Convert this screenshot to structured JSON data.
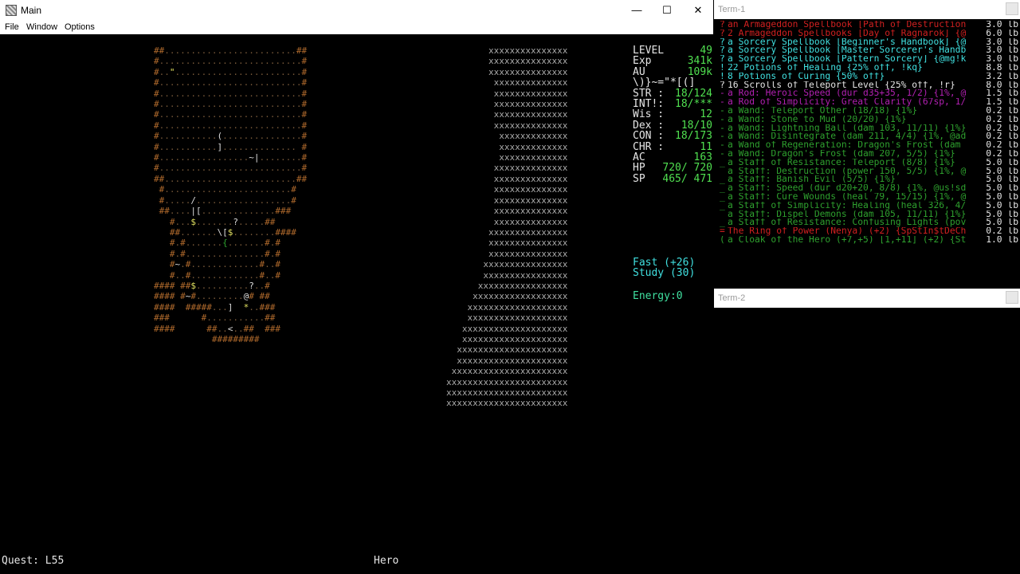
{
  "main_window": {
    "title": "Main",
    "controls": {
      "minimize": "—",
      "maximize": "☐",
      "close": "✕"
    },
    "menu": [
      "File",
      "Window",
      "Options"
    ]
  },
  "map": {
    "dungeon_rows": [
      "##.........................##",
      "#...........................#",
      "#..\"........................#",
      "#...........................#",
      "#...........................#",
      "#...........................#",
      "#...........................#",
      "#...........................#",
      "#...........(...............#",
      "#...........].............. #",
      "#.................~|........#",
      "#...........................#",
      "##.........................##",
      " #........................#",
      " #...../..................#",
      " ##....|[..............###",
      "   #...$.......?.....##",
      "   ##.......\\[$........####",
      "   #.#.......{.......#.#",
      "   #.#...............#.#",
      "   #~.#.............#..#",
      "   #..#.............#..#",
      "#### ##$..........?..#",
      "#### #~#.........@# ##",
      "####  #####...]  *..###",
      "###      #...........##",
      "####      ##..<..##  ###",
      "           #########"
    ],
    "x_rows": [
      "        xxxxxxxxxxxxxxx",
      "        xxxxxxxxxxxxxxx",
      "        xxxxxxxxxxxxxxx",
      "         xxxxxxxxxxxxxx",
      "         xxxxxxxxxxxxxx",
      "         xxxxxxxxxxxxxx",
      "         xxxxxxxxxxxxxx",
      "         xxxxxxxxxxxxxx",
      "          xxxxxxxxxxxxx",
      "          xxxxxxxxxxxxx",
      "          xxxxxxxxxxxxx",
      "         xxxxxxxxxxxxxx",
      "         xxxxxxxxxxxxxx",
      "         xxxxxxxxxxxxxx",
      "         xxxxxxxxxxxxxx",
      "         xxxxxxxxxxxxxx",
      "         xxxxxxxxxxxxxx",
      "        xxxxxxxxxxxxxxx",
      "        xxxxxxxxxxxxxxx",
      "        xxxxxxxxxxxxxxx",
      "       xxxxxxxxxxxxxxxx",
      "       xxxxxxxxxxxxxxxx",
      "      xxxxxxxxxxxxxxxxx",
      "     xxxxxxxxxxxxxxxxxx",
      "    xxxxxxxxxxxxxxxxxxx",
      "    xxxxxxxxxxxxxxxxxxx",
      "   xxxxxxxxxxxxxxxxxxxx",
      "   xxxxxxxxxxxxxxxxxxxx",
      "  xxxxxxxxxxxxxxxxxxxxx",
      "  xxxxxxxxxxxxxxxxxxxxx",
      " xxxxxxxxxxxxxxxxxxxxxx",
      "xxxxxxxxxxxxxxxxxxxxxxx",
      "xxxxxxxxxxxxxxxxxxxxxxx",
      "xxxxxxxxxxxxxxxxxxxxxxx"
    ]
  },
  "stats": [
    {
      "label": "LEVEL",
      "value": "49",
      "color": "#50e050"
    },
    {
      "label": "Exp",
      "value": "341k",
      "color": "#50e050"
    },
    {
      "label": "AU",
      "value": "109k",
      "color": "#50e050"
    },
    {
      "label": "\\)}~=\"*[(]",
      "value": "",
      "color": "#e6e6e6"
    },
    {
      "label": "STR :",
      "value": "18/124",
      "color": "#50e050"
    },
    {
      "label": "INT!:",
      "value": "18/***",
      "color": "#50e050"
    },
    {
      "label": "Wis :",
      "value": "12",
      "color": "#50e050"
    },
    {
      "label": "Dex :",
      "value": "18/10",
      "color": "#50e050"
    },
    {
      "label": "CON :",
      "value": "18/173",
      "color": "#50e050"
    },
    {
      "label": "CHR :",
      "value": "11",
      "color": "#50e050"
    },
    {
      "label": "AC",
      "value": "163",
      "color": "#50e050"
    },
    {
      "label": "HP",
      "value": "720/ 720",
      "color": "#50e050"
    },
    {
      "label": "SP",
      "value": "465/ 471",
      "color": "#50e050"
    }
  ],
  "status": {
    "fast": "Fast (+26)",
    "study": "Study (30)",
    "energy": "Energy:0"
  },
  "bottom": {
    "quest": "Quest: L55",
    "hero": "Hero"
  },
  "term1": {
    "title": "Term-1",
    "items": [
      {
        "sym": "?",
        "text": "an Armageddon Spellbook [Path of Destruction",
        "weight": "3.0 lb",
        "color": "#d02020"
      },
      {
        "sym": "?",
        "text": "2 Armageddon Spellbooks [Day of Ragnarok] {@",
        "weight": "6.0 lb",
        "color": "#d02020"
      },
      {
        "sym": "?",
        "text": "a Sorcery Spellbook [Beginner's Handbook] {@",
        "weight": "3.0 lb",
        "color": "#40e0e0"
      },
      {
        "sym": "?",
        "text": "a Sorcery Spellbook [Master Sorcerer's Handb",
        "weight": "3.0 lb",
        "color": "#40e0e0"
      },
      {
        "sym": "?",
        "text": "a Sorcery Spellbook [Pattern Sorcery] {@mg!k",
        "weight": "3.0 lb",
        "color": "#40e0e0"
      },
      {
        "sym": "!",
        "text": "22 Potions of Healing {25% off, !kq}",
        "weight": "8.8 lb",
        "color": "#40e0e0"
      },
      {
        "sym": "!",
        "text": "8 Potions of Curing {50% off}",
        "weight": "3.2 lb",
        "color": "#40e0e0"
      },
      {
        "sym": "?",
        "text": "16 Scrolls of Teleport Level {25% off, !r}",
        "weight": "8.0 lb",
        "color": "#e6e6e6"
      },
      {
        "sym": "-",
        "text": "a Rod: Heroic Speed (dur d35+35, 1/2) {1%, @",
        "weight": "1.5 lb",
        "color": "#b020b0"
      },
      {
        "sym": "-",
        "text": "a Rod of Simplicity: Great Clarity (67sp, 1/",
        "weight": "1.5 lb",
        "color": "#b020b0"
      },
      {
        "sym": "-",
        "text": "a Wand: Teleport Other (18/18) {1%}",
        "weight": "0.2 lb",
        "color": "#2ea02e"
      },
      {
        "sym": "-",
        "text": "a Wand: Stone to Mud (20/20) {1%}",
        "weight": "0.2 lb",
        "color": "#2ea02e"
      },
      {
        "sym": "-",
        "text": "a Wand: Lightning Ball (dam 103, 11/11) {1%}",
        "weight": "0.2 lb",
        "color": "#2ea02e"
      },
      {
        "sym": "-",
        "text": "a Wand: Disintegrate (dam 211, 4/4) {1%, @ad",
        "weight": "0.2 lb",
        "color": "#2ea02e"
      },
      {
        "sym": "-",
        "text": "a Wand of Regeneration: Dragon's Frost (dam",
        "weight": "0.2 lb",
        "color": "#2ea02e"
      },
      {
        "sym": "-",
        "text": "a Wand: Dragon's Frost (dam 207, 5/5) {1%}",
        "weight": "0.2 lb",
        "color": "#2ea02e"
      },
      {
        "sym": "_",
        "text": "a Staff of Resistance: Teleport (8/8) {1%}",
        "weight": "5.0 lb",
        "color": "#2ea02e"
      },
      {
        "sym": "_",
        "text": "a Staff: Destruction (power 150, 5/5) {1%, @",
        "weight": "5.0 lb",
        "color": "#2ea02e"
      },
      {
        "sym": "_",
        "text": "a Staff: Banish Evil (5/5) {1%}",
        "weight": "5.0 lb",
        "color": "#2ea02e"
      },
      {
        "sym": "_",
        "text": "a Staff: Speed (dur d20+20, 8/8) {1%, @us!sd",
        "weight": "5.0 lb",
        "color": "#2ea02e"
      },
      {
        "sym": "_",
        "text": "a Staff: Cure Wounds (heal 79, 15/15) {1%, @",
        "weight": "5.0 lb",
        "color": "#2ea02e"
      },
      {
        "sym": "_",
        "text": "a Staff of Simplicity: Healing (heal 326, 4/",
        "weight": "5.0 lb",
        "color": "#2ea02e"
      },
      {
        "sym": "_",
        "text": "a Staff: Dispel Demons (dam 105, 11/11) {1%}",
        "weight": "5.0 lb",
        "color": "#2ea02e"
      },
      {
        "sym": "_",
        "text": "a Staff of Resistance: Confusing Lights (pov",
        "weight": "5.0 lb",
        "color": "#2ea02e"
      },
      {
        "sym": "=",
        "text": "The Ring of Power (Nenya) (+2) {SpStIn$tDeCh",
        "weight": "0.2 lb",
        "color": "#d02020"
      },
      {
        "sym": "(",
        "text": "a Cloak of the Hero (+7,+5) [1,+11] (+2) {St",
        "weight": "1.0 lb",
        "color": "#2ea02e"
      }
    ]
  },
  "term2": {
    "title": "Term-2"
  }
}
